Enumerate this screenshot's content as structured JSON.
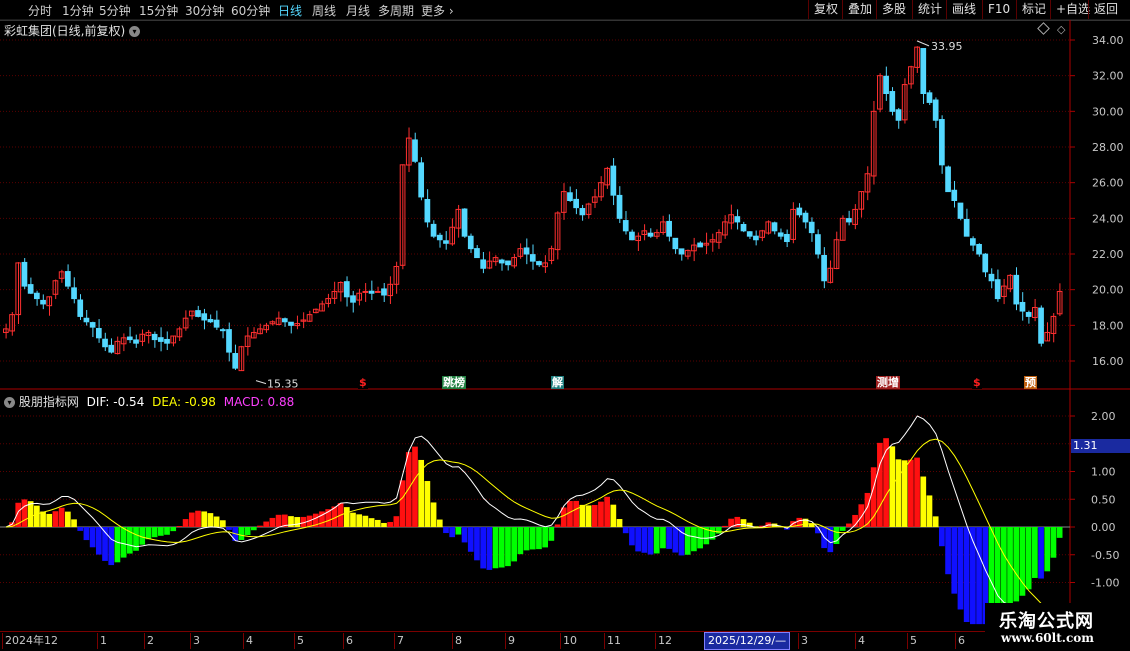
{
  "topbar": {
    "tabs": [
      {
        "label": "分时",
        "x": 28
      },
      {
        "label": "1分钟",
        "x": 62
      },
      {
        "label": "5分钟",
        "x": 99
      },
      {
        "label": "15分钟",
        "x": 139
      },
      {
        "label": "30分钟",
        "x": 185
      },
      {
        "label": "60分钟",
        "x": 231
      },
      {
        "label": "日线",
        "x": 278,
        "active": true
      },
      {
        "label": "周线",
        "x": 312
      },
      {
        "label": "月线",
        "x": 346
      },
      {
        "label": "多周期",
        "x": 378
      },
      {
        "label": "更多 ›",
        "x": 421
      }
    ],
    "tools": [
      {
        "label": "复权",
        "x": 808
      },
      {
        "label": "叠加",
        "x": 842
      },
      {
        "label": "多股",
        "x": 876
      },
      {
        "label": "统计",
        "x": 912
      },
      {
        "label": "画线",
        "x": 946
      },
      {
        "label": "F10",
        "x": 982
      },
      {
        "label": "标记",
        "x": 1016
      },
      {
        "label": "+自选",
        "x": 1050
      },
      {
        "label": "返回",
        "x": 1088
      }
    ]
  },
  "main_chart": {
    "title": "彩虹集团(日线,前复权)",
    "high_label": "33.95",
    "low_label": "15.35",
    "y_ticks": [
      "34.00",
      "32.00",
      "30.00",
      "28.00",
      "26.00",
      "24.00",
      "22.00",
      "20.00",
      "18.00",
      "16.00"
    ],
    "markers": [
      {
        "text": "$",
        "x": 358,
        "color": "#ff2020",
        "bg": "#000"
      },
      {
        "text": "跳榜",
        "x": 442,
        "color": "#ffffff",
        "bg": "#208040"
      },
      {
        "text": "解",
        "x": 551,
        "color": "#ffffff",
        "bg": "#208080"
      },
      {
        "text": "测增",
        "x": 876,
        "color": "#ffffff",
        "bg": "#a02020"
      },
      {
        "text": "$",
        "x": 972,
        "color": "#ff2020",
        "bg": "#000"
      },
      {
        "text": "预",
        "x": 1024,
        "color": "#ffffff",
        "bg": "#c06010"
      }
    ]
  },
  "macd": {
    "name": "股朋指标网",
    "dif_label": "DIF: -0.54",
    "dea_label": "DEA: -0.98",
    "macd_label": "MACD: 0.88",
    "y_ticks": [
      "2.00",
      "1.50",
      "1.00",
      "0.50",
      "0.00",
      "-0.50",
      "-1.00"
    ],
    "current_value": "1.31"
  },
  "date_axis": {
    "labels": [
      {
        "text": "2024年12",
        "x": 2
      },
      {
        "text": "1",
        "x": 97
      },
      {
        "text": "2",
        "x": 144
      },
      {
        "text": "3",
        "x": 190
      },
      {
        "text": "4",
        "x": 243
      },
      {
        "text": "5",
        "x": 294
      },
      {
        "text": "6",
        "x": 343
      },
      {
        "text": "7",
        "x": 394
      },
      {
        "text": "8",
        "x": 452
      },
      {
        "text": "9",
        "x": 505
      },
      {
        "text": "10",
        "x": 560
      },
      {
        "text": "11",
        "x": 604
      },
      {
        "text": "12",
        "x": 655
      },
      {
        "text": "3",
        "x": 798
      },
      {
        "text": "4",
        "x": 855
      },
      {
        "text": "5",
        "x": 907
      },
      {
        "text": "6",
        "x": 955
      }
    ],
    "cursor_date": "2025/12/29/—"
  },
  "watermark": {
    "line1": "乐淘公式网",
    "line2": "www.60lt.com"
  },
  "colors": {
    "up": "#ff3030",
    "down": "#54d8ff",
    "grid": "#5a0000",
    "axis": "#aa0000",
    "text": "#c8c8c8"
  },
  "chart_data": {
    "type": "candlestick",
    "ylim": [
      15,
      35
    ],
    "closes": [
      17.8,
      18.6,
      21.5,
      20.2,
      19.8,
      19.5,
      19.2,
      19.6,
      20.5,
      21.0,
      20.2,
      19.5,
      18.5,
      18.2,
      17.9,
      17.3,
      16.8,
      16.5,
      17.1,
      17.3,
      17.2,
      17.0,
      17.5,
      17.6,
      17.2,
      17.1,
      17.0,
      17.4,
      17.8,
      18.4,
      18.8,
      18.5,
      18.3,
      18.2,
      17.9,
      17.7,
      16.5,
      15.6,
      16.8,
      17.4,
      17.6,
      17.8,
      18.0,
      18.2,
      18.4,
      18.2,
      18.0,
      18.1,
      18.3,
      18.6,
      18.9,
      19.2,
      19.5,
      19.9,
      20.4,
      19.6,
      19.3,
      19.8,
      19.9,
      19.8,
      19.9,
      19.7,
      20.3,
      21.3,
      27.0,
      28.5,
      27.2,
      25.2,
      23.8,
      23.0,
      22.8,
      22.6,
      23.5,
      24.5,
      23.0,
      22.3,
      21.8,
      21.2,
      21.6,
      21.8,
      21.5,
      21.4,
      21.8,
      22.3,
      22.0,
      21.6,
      21.4,
      21.5,
      22.3,
      24.3,
      25.5,
      25.0,
      24.6,
      24.2,
      24.8,
      25.2,
      26.0,
      26.8,
      25.3,
      24.0,
      23.3,
      22.8,
      23.0,
      23.3,
      23.0,
      23.2,
      23.8,
      23.0,
      22.3,
      22.0,
      22.2,
      22.5,
      22.4,
      22.6,
      22.8,
      23.2,
      23.8,
      24.2,
      23.8,
      23.3,
      23.0,
      22.8,
      23.3,
      23.8,
      23.3,
      23.0,
      22.7,
      24.5,
      24.2,
      23.8,
      23.2,
      22.0,
      20.5,
      21.2,
      22.8,
      24.0,
      23.8,
      24.5,
      25.5,
      26.5,
      30.0,
      32.0,
      31.0,
      30.0,
      29.5,
      31.5,
      32.5,
      33.6,
      31.0,
      30.5,
      29.5,
      27.0,
      25.5,
      25.0,
      24.0,
      23.0,
      22.5,
      22.0,
      21.0,
      20.5,
      19.5,
      20.2,
      20.8,
      19.2,
      18.8,
      18.5,
      19.0,
      17.0,
      17.6,
      18.5,
      19.9
    ]
  }
}
